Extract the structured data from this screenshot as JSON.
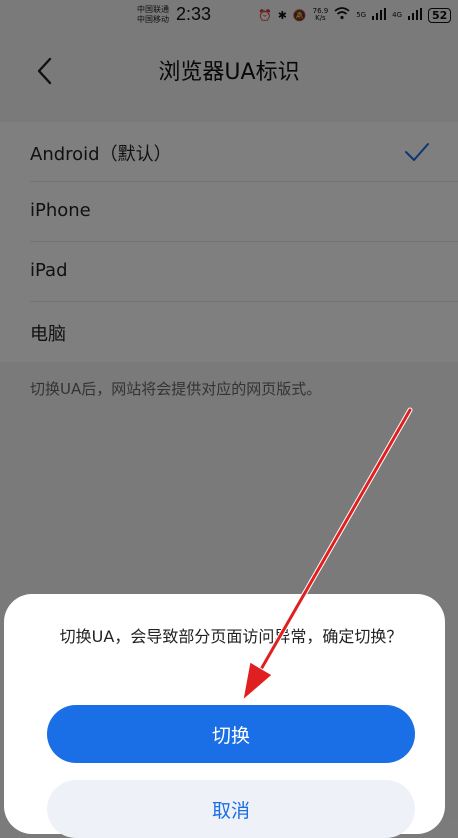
{
  "status_bar": {
    "carrier_1": "中国联通",
    "carrier_2": "中国移动",
    "time": "2:33",
    "speed_value": "76.9",
    "speed_unit": "K/s",
    "net_5g": "5G",
    "net_4g": "4G",
    "battery": "52"
  },
  "nav": {
    "title": "浏览器UA标识",
    "back_icon": "chevron-left-icon"
  },
  "ua_options": [
    {
      "label": "Android（默认）",
      "selected": true
    },
    {
      "label": "iPhone",
      "selected": false
    },
    {
      "label": "iPad",
      "selected": false
    },
    {
      "label": "电脑",
      "selected": false
    }
  ],
  "hint": "切换UA后，网站将会提供对应的网页版式。",
  "dialog": {
    "message": "切换UA，会导致部分页面访问异常，确定切换？",
    "confirm_label": "切换",
    "cancel_label": "取消"
  },
  "colors": {
    "accent": "#1a6fe6",
    "annotation_arrow": "#e02020"
  }
}
